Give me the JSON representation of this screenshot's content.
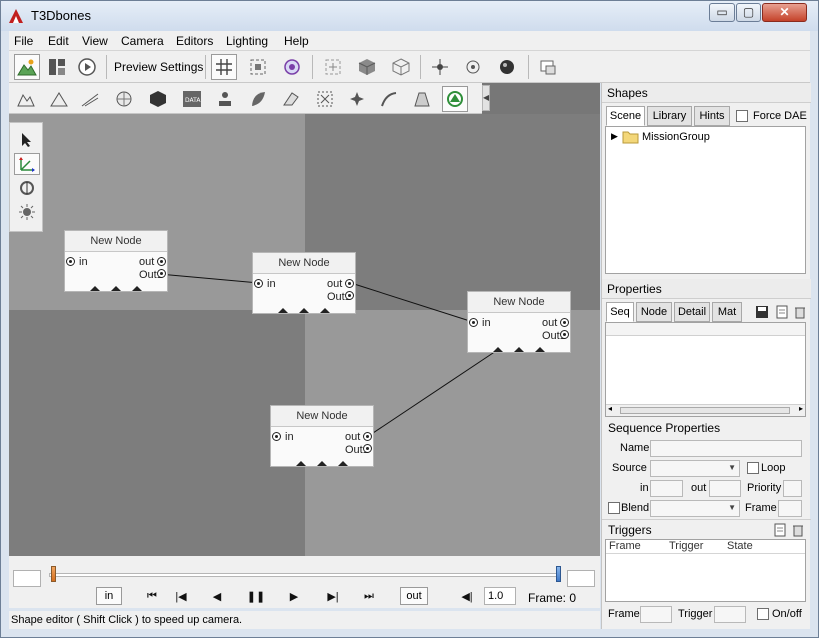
{
  "window": {
    "title": "T3Dbones",
    "minimize_glyph": "▭",
    "maximize_glyph": "▢",
    "close_glyph": "✕"
  },
  "menu": {
    "items": [
      "File",
      "Edit",
      "View",
      "Camera",
      "Editors",
      "Lighting",
      "Help"
    ]
  },
  "toolbar": {
    "preview_settings_label": "Preview Settings"
  },
  "nodes": [
    {
      "title": "New Node",
      "in": "in",
      "out": "out",
      "out1": "Out1"
    },
    {
      "title": "New Node",
      "in": "in",
      "out": "out",
      "out1": "Out1"
    },
    {
      "title": "New Node",
      "in": "in",
      "out": "out",
      "out1": "Out1"
    },
    {
      "title": "New Node",
      "in": "in",
      "out": "out",
      "out1": "Out1"
    }
  ],
  "timeline": {
    "in_label": "in",
    "out_label": "out",
    "speed": "1.0",
    "frame_label": "Frame:",
    "frame_value": "0",
    "range_start_frame": "",
    "range_end_frame": "",
    "position_fraction": 0.0,
    "end_fraction": 1.0
  },
  "status": {
    "text": "Shape editor ( Shift Click ) to speed up camera."
  },
  "shapes": {
    "header": "Shapes",
    "tabs": [
      "Scene",
      "Library",
      "Hints"
    ],
    "active_tab": "Scene",
    "force_dae_label": "Force DAE",
    "force_dae_checked": false,
    "tree": [
      {
        "label": "MissionGroup",
        "expanded": false
      }
    ]
  },
  "properties": {
    "header": "Properties",
    "tabs": [
      "Seq",
      "Node",
      "Detail",
      "Mat"
    ],
    "active_tab": "Seq"
  },
  "sequence_properties": {
    "header": "Sequence Properties",
    "name_label": "Name",
    "name_value": "",
    "source_label": "Source",
    "source_value": "",
    "loop_label": "Loop",
    "loop_checked": false,
    "in_label": "in",
    "in_value": "",
    "out_label": "out",
    "out_value": "",
    "priority_label": "Priority",
    "priority_value": "",
    "blend_label": "Blend",
    "blend_checked": false,
    "blend_value": "",
    "frame_label": "Frame",
    "frame_value": ""
  },
  "triggers": {
    "header": "Triggers",
    "columns": [
      "Frame",
      "Trigger",
      "State"
    ],
    "rows": [],
    "frame_label": "Frame",
    "frame_value": "",
    "trigger_label": "Trigger",
    "trigger_value": "",
    "onoff_label": "On/off",
    "onoff_checked": false
  },
  "colors": {
    "window_frame": "#dbe4ef",
    "viewport_light": "#999999",
    "viewport_dark": "#7d7d7d",
    "panel": "#f0f0f0",
    "accent_orange": "#d76f1f",
    "accent_blue": "#3f78c7"
  }
}
